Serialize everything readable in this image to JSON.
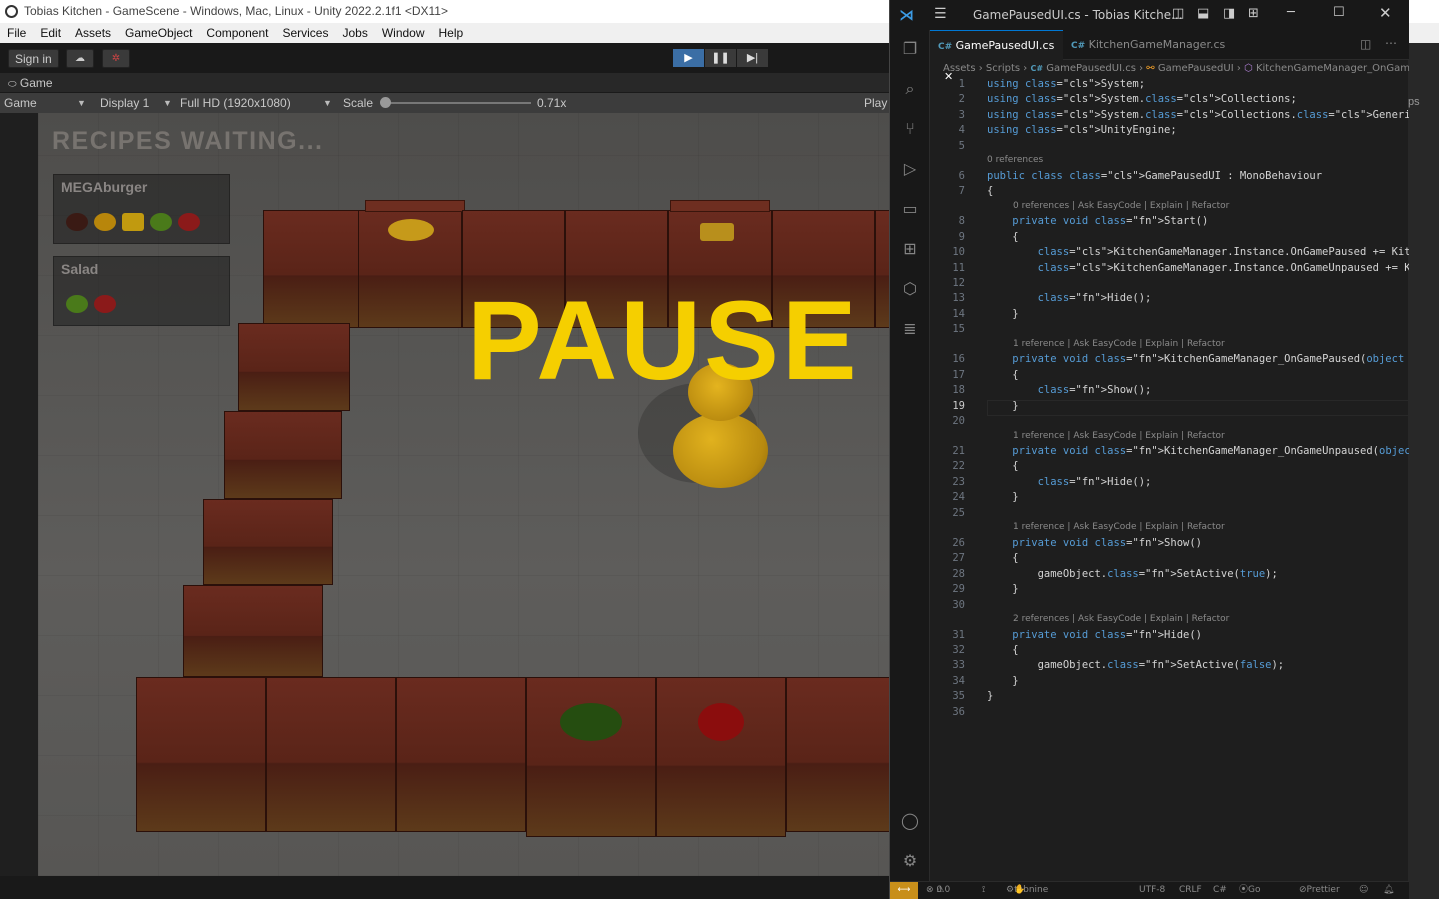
{
  "unity": {
    "title": "Tobias Kitchen - GameScene - Windows, Mac, Linux - Unity 2022.2.1f1 <DX11>",
    "menu": [
      "File",
      "Edit",
      "Assets",
      "GameObject",
      "Component",
      "Services",
      "Jobs",
      "Window",
      "Help"
    ],
    "toolbar": {
      "sign_in": "Sign in"
    },
    "game_tab": "Game",
    "game_bar": {
      "view": "Game",
      "display": "Display 1",
      "resolution": "Full HD (1920x1080)",
      "scale_label": "Scale",
      "scale_value": "0.71x",
      "play_label": "Play"
    },
    "right_tab_fragment": "ps"
  },
  "game": {
    "recipes_title": "RECIPES WAITING...",
    "recipes": [
      {
        "name": "MEGAburger"
      },
      {
        "name": "Salad"
      }
    ],
    "pause_text": "PAUSE"
  },
  "vscode": {
    "title": "GamePausedUI.cs - Tobias Kitche...",
    "tabs": [
      {
        "label": "GamePausedUI.cs",
        "active": true
      },
      {
        "label": "KitchenGameManager.cs",
        "active": false
      }
    ],
    "breadcrumb": [
      "Assets",
      "Scripts",
      "GamePausedUI.cs",
      "GamePausedUI",
      "KitchenGameManager_OnGam"
    ],
    "lines": [
      {
        "n": "1",
        "code": "using System;"
      },
      {
        "n": "2",
        "code": "using System.Collections;"
      },
      {
        "n": "3",
        "code": "using System.Collections.Generic;"
      },
      {
        "n": "4",
        "code": "using UnityEngine;"
      },
      {
        "n": "5",
        "code": ""
      },
      {
        "n": "6",
        "code": "public class GamePausedUI : MonoBehaviour",
        "lens": "0 references"
      },
      {
        "n": "7",
        "code": "{"
      },
      {
        "n": "8",
        "code": "    private void Start()",
        "lens": "0 references | Ask EasyCode | Explain | Refactor"
      },
      {
        "n": "9",
        "code": "    {"
      },
      {
        "n": "10",
        "code": "        KitchenGameManager.Instance.OnGamePaused += KitchenGameMan"
      },
      {
        "n": "11",
        "code": "        KitchenGameManager.Instance.OnGameUnpaused += KitchenGameM"
      },
      {
        "n": "12",
        "code": ""
      },
      {
        "n": "13",
        "code": "        Hide();"
      },
      {
        "n": "14",
        "code": "    }"
      },
      {
        "n": "15",
        "code": ""
      },
      {
        "n": "16",
        "code": "    private void KitchenGameManager_OnGamePaused(object sender, Ev",
        "lens": "1 reference | Ask EasyCode | Explain | Refactor"
      },
      {
        "n": "17",
        "code": "    {"
      },
      {
        "n": "18",
        "code": "        Show();"
      },
      {
        "n": "19",
        "code": "    }"
      },
      {
        "n": "20",
        "code": ""
      },
      {
        "n": "21",
        "code": "    private void KitchenGameManager_OnGameUnpaused(object sender,",
        "lens": "1 reference | Ask EasyCode | Explain | Refactor"
      },
      {
        "n": "22",
        "code": "    {"
      },
      {
        "n": "23",
        "code": "        Hide();"
      },
      {
        "n": "24",
        "code": "    }"
      },
      {
        "n": "25",
        "code": ""
      },
      {
        "n": "26",
        "code": "    private void Show()",
        "lens": "1 reference | Ask EasyCode | Explain | Refactor"
      },
      {
        "n": "27",
        "code": "    {"
      },
      {
        "n": "28",
        "code": "        gameObject.SetActive(true);"
      },
      {
        "n": "29",
        "code": "    }"
      },
      {
        "n": "30",
        "code": ""
      },
      {
        "n": "31",
        "code": "    private void Hide()",
        "lens": "2 references | Ask EasyCode | Explain | Refactor"
      },
      {
        "n": "32",
        "code": "    {"
      },
      {
        "n": "33",
        "code": "        gameObject.SetActive(false);"
      },
      {
        "n": "34",
        "code": "    }"
      },
      {
        "n": "35",
        "code": "}"
      },
      {
        "n": "36",
        "code": ""
      }
    ],
    "status": {
      "problems": "0",
      "warnings": "0",
      "tabnine": "tabnine starter",
      "encoding": "UTF-8",
      "eol": "CRLF",
      "lang": "C#",
      "golive": "Go Live",
      "prettier": "Prettier"
    }
  }
}
